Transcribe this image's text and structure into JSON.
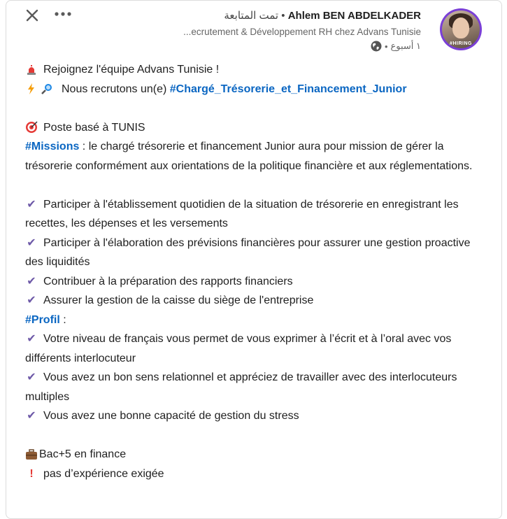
{
  "header": {
    "author_name": "Ahlem BEN ABDELKADER",
    "follow_status": "تمت المتابعة",
    "separator": "•",
    "headline": "...ecrutement & Développement RH chez Advans Tunisie",
    "time_ago": "١ أسبوع",
    "avatar_badge": "#HIRING",
    "close_icon": "close-icon",
    "more_icon": "more-icon",
    "visibility_icon": "globe-icon"
  },
  "post": {
    "line1": "Rejoignez l'équipe Advans Tunisie !",
    "line2_prefix": "Nous recrutons un(e) ",
    "line2_hashtag": "#Chargé_Trésorerie_et_Financement_Junior",
    "location": "Poste basé à TUNIS",
    "missions_tag": "#Missions",
    "missions_text": " : le chargé trésorerie et financement Junior aura pour mission de gérer la trésorerie conformément aux orientations de la politique financière et aux réglementations.",
    "missions": [
      "Participer à l'établissement quotidien de la situation de trésorerie en enregistrant les recettes, les dépenses et les versements",
      "Participer à l'élaboration des prévisions financières pour assurer une gestion proactive des liquidités",
      "Contribuer à la préparation des rapports financiers",
      "Assurer la gestion de la caisse du siège de l'entreprise"
    ],
    "profil_tag": "#Profil",
    "profil_suffix": " :",
    "profil": [
      "Votre niveau de français vous permet de vous exprimer à l’écrit et à l’oral avec vos différents interlocuteur",
      "Vous avez un bon sens relationnel et appréciez de travailler avec des interlocuteurs multiples",
      "Vous avez une bonne capacité de gestion du stress"
    ],
    "education": "Bac+5 en finance",
    "experience": "pas d’expérience exigée"
  },
  "colors": {
    "hashtag": "#0a66c2",
    "check": "#6e5aa8",
    "avatar_ring": "#7a3fd6"
  }
}
